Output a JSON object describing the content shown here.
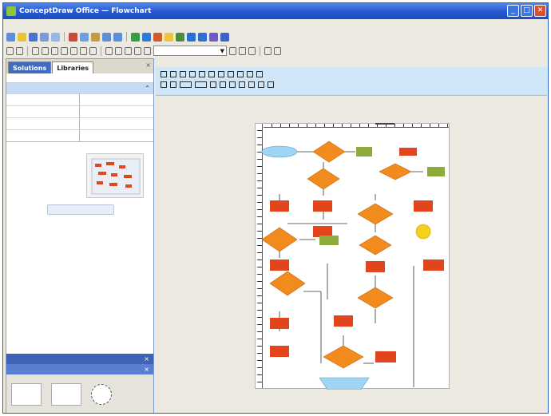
{
  "window": {
    "title": "ConceptDraw Office — Flowchart"
  },
  "menu": [],
  "sidebar": {
    "tabs": [
      "Solutions",
      "Libraries"
    ],
    "section_rows": [
      "",
      ""
    ],
    "grid_cells": [
      "",
      "",
      "",
      "",
      "",
      "",
      "",
      ""
    ],
    "promo_heading": "",
    "promo_texts": [
      "",
      "",
      ""
    ],
    "promo_button": "",
    "libraries": [
      "",
      ""
    ]
  },
  "toolbar": {
    "zoom_value": ""
  },
  "canvas": {
    "page_title": "",
    "mini_tabs": [
      "",
      "",
      ""
    ]
  },
  "colors": {
    "titlebar": "#2457cf",
    "sidebar_tab_active": "#3f6cc0",
    "library_selected": "#3d64b6",
    "ribbon": "#cfe5f8",
    "flow_decision": "#f28b1e",
    "flow_process": "#e2441c",
    "flow_terminal": "#9fd4f2",
    "flow_green": "#8cab3a",
    "flow_yellow": "#f6d11b"
  }
}
